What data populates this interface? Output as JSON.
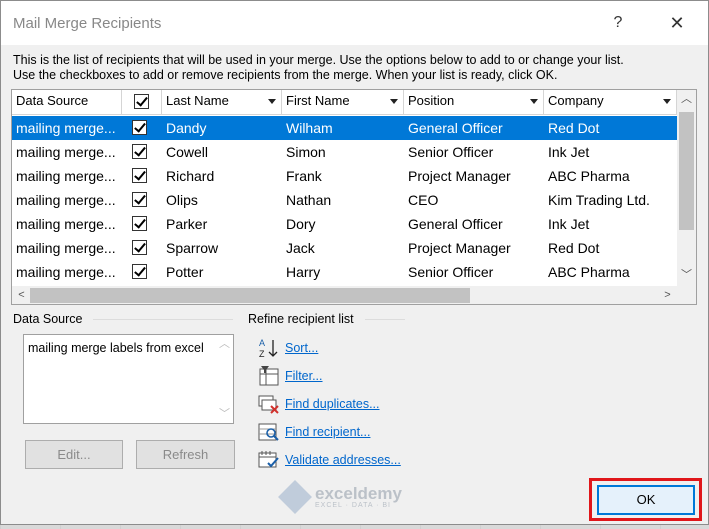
{
  "window": {
    "title": "Mail Merge Recipients",
    "help_glyph": "?",
    "close_glyph": "✕"
  },
  "intro": {
    "line1": "This is the list of recipients that will be used in your merge.  Use the options below to add to or change your list.",
    "line2": "Use the checkboxes to add or remove recipients from the merge.  When your list is ready, click OK."
  },
  "grid": {
    "columns": [
      "Data Source",
      "",
      "Last Name",
      "First Name",
      "Position",
      "Company"
    ],
    "rows": [
      {
        "source": "mailing merge...",
        "checked": true,
        "last": "Dandy",
        "first": "Wilham",
        "position": "General Officer",
        "company": "Red Dot",
        "selected": true
      },
      {
        "source": "mailing merge...",
        "checked": true,
        "last": "Cowell",
        "first": "Simon",
        "position": "Senior Officer",
        "company": "Ink Jet",
        "selected": false
      },
      {
        "source": "mailing merge...",
        "checked": true,
        "last": "Richard",
        "first": "Frank",
        "position": "Project Manager",
        "company": "ABC Pharma",
        "selected": false
      },
      {
        "source": "mailing merge...",
        "checked": true,
        "last": "Olips",
        "first": "Nathan",
        "position": "CEO",
        "company": "Kim Trading Ltd.",
        "selected": false
      },
      {
        "source": "mailing merge...",
        "checked": true,
        "last": "Parker",
        "first": "Dory",
        "position": "General Officer",
        "company": "Ink Jet",
        "selected": false
      },
      {
        "source": "mailing merge...",
        "checked": true,
        "last": "Sparrow",
        "first": "Jack",
        "position": "Project Manager",
        "company": "Red Dot",
        "selected": false
      },
      {
        "source": "mailing merge...",
        "checked": true,
        "last": "Potter",
        "first": "Harry",
        "position": "Senior Officer",
        "company": "ABC Pharma",
        "selected": false
      }
    ]
  },
  "data_source": {
    "label": "Data Source",
    "value": "mailing merge labels from excel",
    "edit_label": "Edit...",
    "refresh_label": "Refresh"
  },
  "refine": {
    "label": "Refine recipient list",
    "sort": "Sort...",
    "filter": "Filter...",
    "duplicates": "Find duplicates...",
    "find": "Find recipient...",
    "validate": "Validate addresses..."
  },
  "footer": {
    "ok_label": "OK",
    "watermark_name": "exceldemy",
    "watermark_sub": "EXCEL · DATA · BI"
  },
  "colors": {
    "selection": "#0078d7",
    "link": "#0066cc",
    "highlight": "#e0161a"
  }
}
